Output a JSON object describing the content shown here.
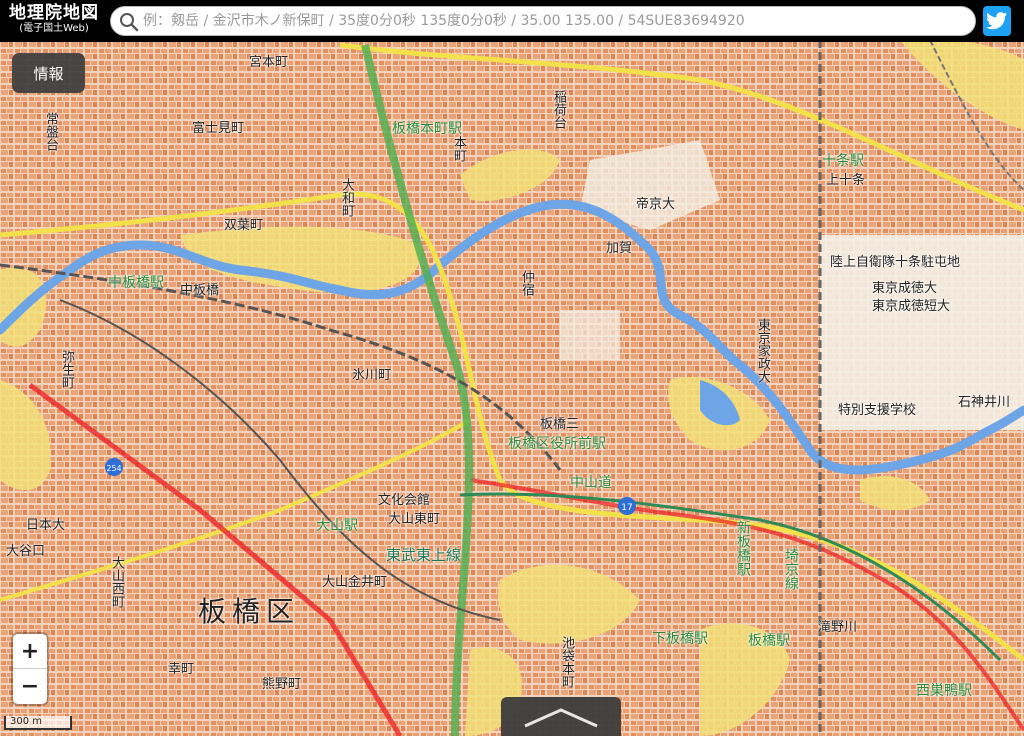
{
  "header": {
    "logo_title": "地理院地図",
    "logo_subtitle": "(電子国土Web)",
    "search_placeholder": "例：剱岳 / 金沢市木ノ新保町 / 35度0分0秒 135度0分0秒 / 35.00 135.00 / 54SUE83694920",
    "twitter_icon": "twitter-icon"
  },
  "controls": {
    "info_label": "情報",
    "zoom_in_label": "+",
    "zoom_out_label": "−",
    "scale_label": "300 m",
    "expand_icon": "chevron-up-icon"
  },
  "colors": {
    "urban_area": "#e9a47a",
    "river": "#6ea5e6",
    "flood_zone": "#f3e07a",
    "national_road": "#ed1c24",
    "jr_line": "#e23b3b",
    "private_line": "#2e8b57",
    "expressway": "#4caf50"
  },
  "map": {
    "labels": [
      "中板橋駅",
      "中板橋",
      "双葉町",
      "大和町",
      "板橋本町駅",
      "宮本町",
      "富士見町",
      "帝京大",
      "加賀",
      "仲宿",
      "十条駅",
      "上十条",
      "陸上自衛隊十条駐屯地",
      "東京成徳大",
      "東京成徳短大",
      "東京家政大",
      "特別支援学校",
      "氷川町",
      "板橋区役所前駅",
      "中山道",
      "板橋三",
      "大山駅",
      "文化会館",
      "大山東町",
      "大山金井町",
      "東武東上線",
      "板橋区",
      "板橋駅",
      "下板橋駅",
      "滝野川",
      "埼京線",
      "西巣鴨駅",
      "新板橋駅",
      "熊野町",
      "大山西町",
      "日本大",
      "弥生町",
      "常盤台",
      "稲荷台",
      "本町",
      "大谷口",
      "石神井川",
      "池袋本町",
      "幸町"
    ],
    "route_markers": [
      "254",
      "17"
    ]
  }
}
